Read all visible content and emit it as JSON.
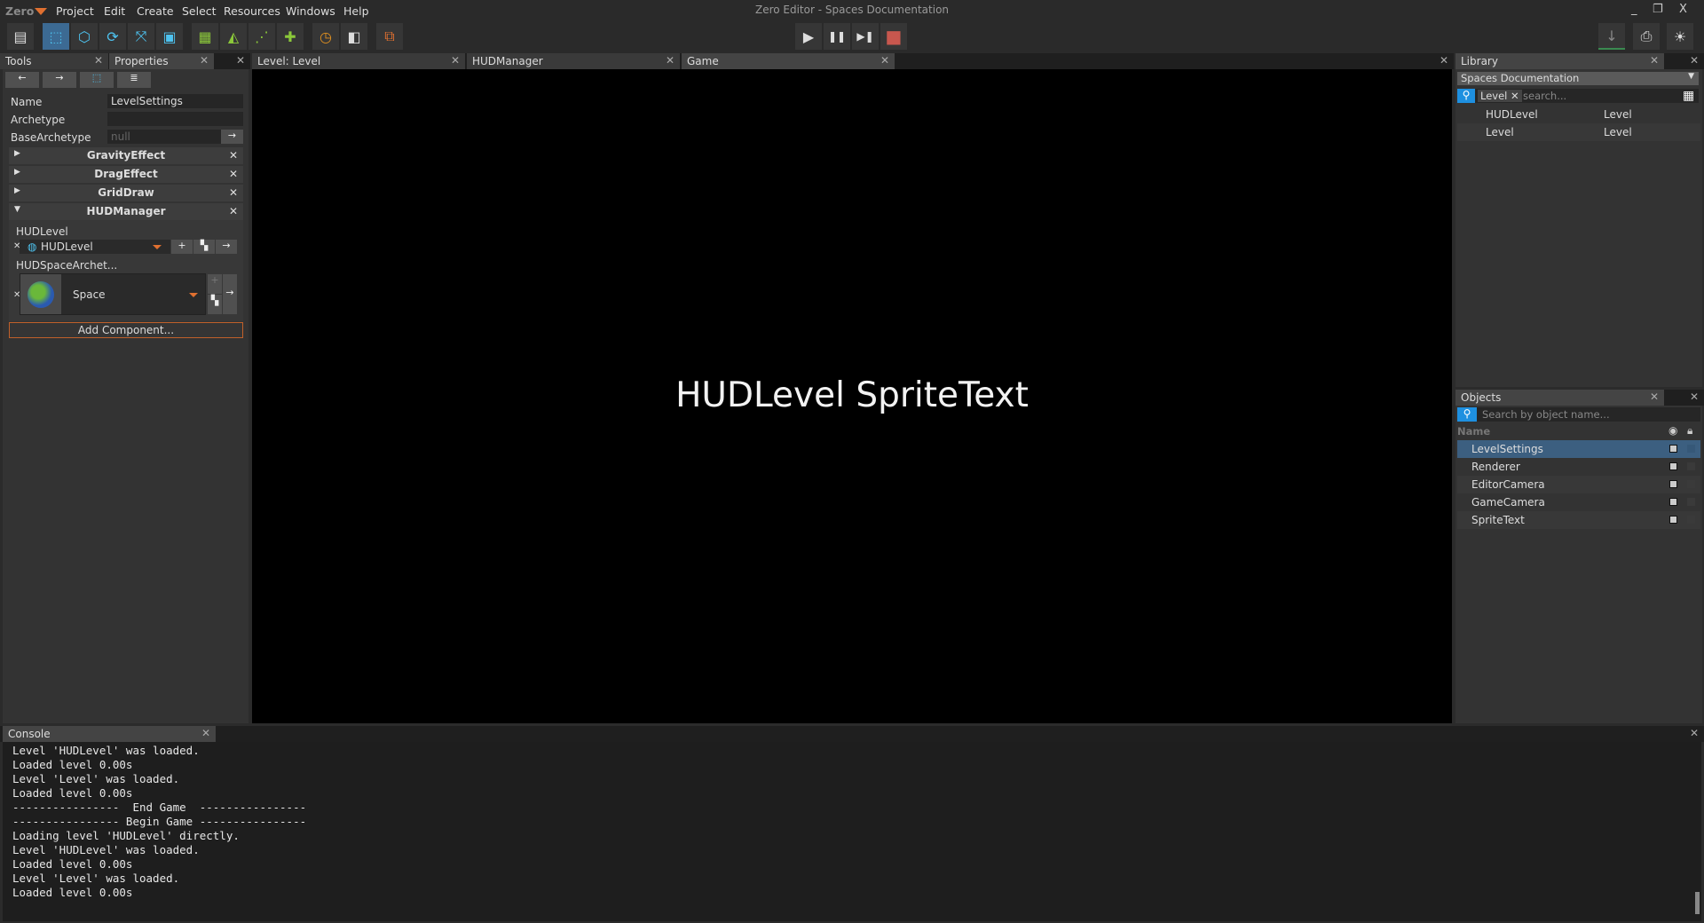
{
  "window": {
    "title": "Zero Editor - Spaces Documentation",
    "app_menu": "Zero",
    "min": "_",
    "max": "❐",
    "close": "X"
  },
  "menu": [
    "Project",
    "Edit",
    "Create",
    "Select",
    "Resources",
    "Windows",
    "Help"
  ],
  "toolbar": {
    "play": "▶",
    "pause": "❚❚",
    "step": "▶❚",
    "stop": "■"
  },
  "left_tabs": [
    {
      "label": "Tools"
    },
    {
      "label": "Properties"
    }
  ],
  "properties": {
    "name_label": "Name",
    "name_value": "LevelSettings",
    "archetype_label": "Archetype",
    "archetype_value": "",
    "base_label": "BaseArchetype",
    "base_value": "null",
    "components": [
      "GravityEffect",
      "DragEffect",
      "GridDraw",
      "HUDManager"
    ],
    "hud_level_label": "HUDLevel",
    "hud_level_value": "HUDLevel",
    "hud_space_label": "HUDSpaceArchet...",
    "hud_space_value": "Space",
    "add_component": "Add Component..."
  },
  "center_tabs": [
    {
      "label": "Level: Level"
    },
    {
      "label": "HUDManager"
    },
    {
      "label": "Game"
    }
  ],
  "game": {
    "text": "HUDLevel SpriteText"
  },
  "library": {
    "title": "Library",
    "project": "Spaces Documentation",
    "filter_tag": "Level",
    "search_placeholder": "search...",
    "items": [
      {
        "name": "HUDLevel",
        "type": "Level"
      },
      {
        "name": "Level",
        "type": "Level"
      }
    ]
  },
  "objects": {
    "title": "Objects",
    "search_placeholder": "Search by object name...",
    "column": "Name",
    "items": [
      "LevelSettings",
      "Renderer",
      "EditorCamera",
      "GameCamera",
      "SpriteText"
    ],
    "selected": "LevelSettings"
  },
  "console": {
    "title": "Console",
    "lines": [
      "Level 'HUDLevel' was loaded.",
      "Loaded level 0.00s",
      "Level 'Level' was loaded.",
      "Loaded level 0.00s",
      "----------------  End Game  ----------------",
      "---------------- Begin Game ----------------",
      "Loading level 'HUDLevel' directly.",
      "Level 'HUDLevel' was loaded.",
      "Loaded level 0.00s",
      "Level 'Level' was loaded.",
      "Loaded level 0.00s"
    ]
  },
  "colors": {
    "accent": "#3c6a93",
    "orange": "#e07030",
    "stop": "#c8574e",
    "search": "#1e90e0"
  }
}
